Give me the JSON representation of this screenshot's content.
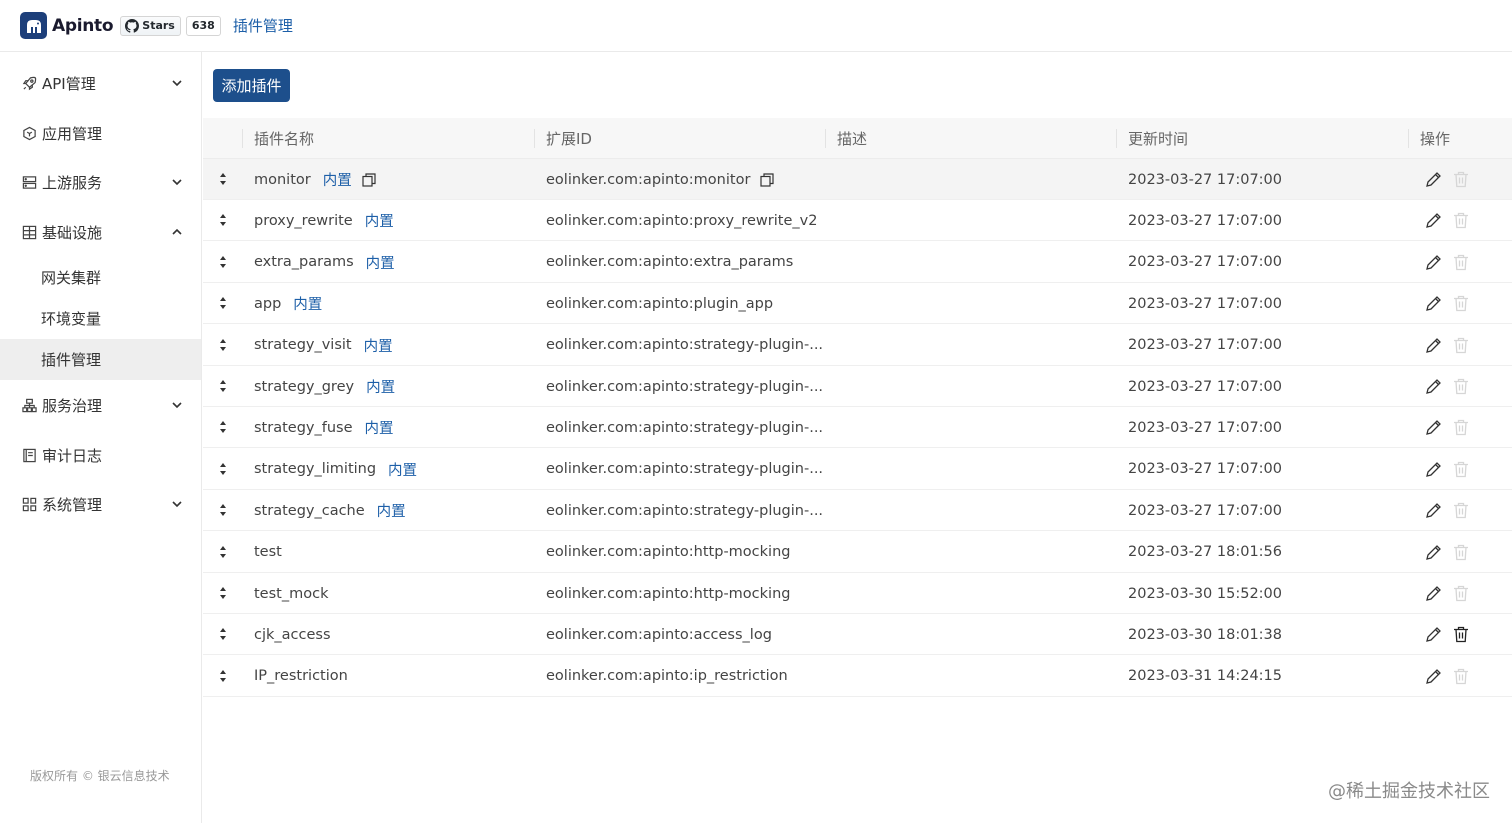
{
  "header": {
    "app_name": "Apinto",
    "github_stars_label": "Stars",
    "github_stars_count": "638",
    "breadcrumb": "插件管理"
  },
  "sidebar": {
    "items": [
      {
        "label": "API管理",
        "icon": "rocket-icon",
        "expandable": true,
        "expanded": false
      },
      {
        "label": "应用管理",
        "icon": "cube-icon",
        "expandable": false
      },
      {
        "label": "上游服务",
        "icon": "server-icon",
        "expandable": true,
        "expanded": false
      },
      {
        "label": "基础设施",
        "icon": "grid-icon",
        "expandable": true,
        "expanded": true
      },
      {
        "label": "服务治理",
        "icon": "network-icon",
        "expandable": true,
        "expanded": false
      },
      {
        "label": "审计日志",
        "icon": "book-icon",
        "expandable": false
      },
      {
        "label": "系统管理",
        "icon": "apps-icon",
        "expandable": true,
        "expanded": false
      }
    ],
    "sub_items": [
      {
        "label": "网关集群",
        "active": false
      },
      {
        "label": "环境变量",
        "active": false
      },
      {
        "label": "插件管理",
        "active": true
      }
    ],
    "copyright": "版权所有 © 银云信息技术"
  },
  "toolbar": {
    "add_label": "添加插件"
  },
  "table": {
    "columns": [
      "插件名称",
      "扩展ID",
      "描述",
      "更新时间",
      "操作"
    ],
    "builtin_tag": "内置",
    "rows": [
      {
        "name": "monitor",
        "builtin": true,
        "ext_id": "eolinker.com:apinto:monitor",
        "desc": "",
        "updated": "2023-03-27 17:07:00",
        "deletable": false
      },
      {
        "name": "proxy_rewrite",
        "builtin": true,
        "ext_id": "eolinker.com:apinto:proxy_rewrite_v2",
        "desc": "",
        "updated": "2023-03-27 17:07:00",
        "deletable": false
      },
      {
        "name": "extra_params",
        "builtin": true,
        "ext_id": "eolinker.com:apinto:extra_params",
        "desc": "",
        "updated": "2023-03-27 17:07:00",
        "deletable": false
      },
      {
        "name": "app",
        "builtin": true,
        "ext_id": "eolinker.com:apinto:plugin_app",
        "desc": "",
        "updated": "2023-03-27 17:07:00",
        "deletable": false
      },
      {
        "name": "strategy_visit",
        "builtin": true,
        "ext_id": "eolinker.com:apinto:strategy-plugin-...",
        "desc": "",
        "updated": "2023-03-27 17:07:00",
        "deletable": false
      },
      {
        "name": "strategy_grey",
        "builtin": true,
        "ext_id": "eolinker.com:apinto:strategy-plugin-...",
        "desc": "",
        "updated": "2023-03-27 17:07:00",
        "deletable": false
      },
      {
        "name": "strategy_fuse",
        "builtin": true,
        "ext_id": "eolinker.com:apinto:strategy-plugin-...",
        "desc": "",
        "updated": "2023-03-27 17:07:00",
        "deletable": false
      },
      {
        "name": "strategy_limiting",
        "builtin": true,
        "ext_id": "eolinker.com:apinto:strategy-plugin-...",
        "desc": "",
        "updated": "2023-03-27 17:07:00",
        "deletable": false
      },
      {
        "name": "strategy_cache",
        "builtin": true,
        "ext_id": "eolinker.com:apinto:strategy-plugin-...",
        "desc": "",
        "updated": "2023-03-27 17:07:00",
        "deletable": false
      },
      {
        "name": "test",
        "builtin": false,
        "ext_id": "eolinker.com:apinto:http-mocking",
        "desc": "",
        "updated": "2023-03-27 18:01:56",
        "deletable": false
      },
      {
        "name": "test_mock",
        "builtin": false,
        "ext_id": "eolinker.com:apinto:http-mocking",
        "desc": "",
        "updated": "2023-03-30 15:52:00",
        "deletable": false
      },
      {
        "name": "cjk_access",
        "builtin": false,
        "ext_id": "eolinker.com:apinto:access_log",
        "desc": "",
        "updated": "2023-03-30 18:01:38",
        "deletable": true
      },
      {
        "name": "IP_restriction",
        "builtin": false,
        "ext_id": "eolinker.com:apinto:ip_restriction",
        "desc": "",
        "updated": "2023-03-31 14:24:15",
        "deletable": false
      }
    ]
  },
  "watermark": "@稀土掘金技术社区",
  "colors": {
    "brand": "#1d3f7a",
    "primary_button": "#1d4f8c",
    "link_tag": "#1d5fa8",
    "active_nav_bg": "#eeeeee"
  }
}
